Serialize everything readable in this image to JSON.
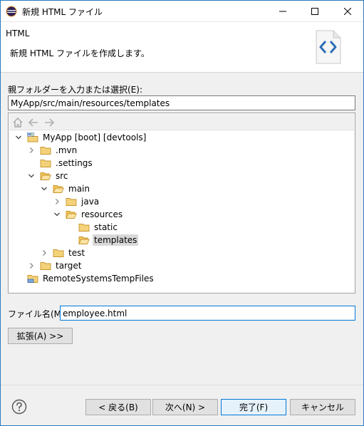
{
  "window": {
    "title": "新規 HTML ファイル",
    "controls": {
      "minimize": "minimize-icon",
      "maximize": "maximize-icon",
      "close": "close-icon"
    }
  },
  "banner": {
    "title": "HTML",
    "description": "新規 HTML ファイルを作成します。"
  },
  "parent_folder": {
    "label": "親フォルダーを入力または選択(E):",
    "value": "MyApp/src/main/resources/templates"
  },
  "tree": {
    "toolbar": [
      "home-icon",
      "back-arrow-icon",
      "forward-arrow-icon"
    ],
    "items": [
      {
        "label": "MyApp [boot] [devtools]",
        "depth": 0,
        "expander": "expanded",
        "icon": "project-icon"
      },
      {
        "label": ".mvn",
        "depth": 1,
        "expander": "collapsed",
        "icon": "folder-icon"
      },
      {
        "label": ".settings",
        "depth": 1,
        "expander": "none",
        "icon": "folder-icon"
      },
      {
        "label": "src",
        "depth": 1,
        "expander": "expanded",
        "icon": "folder-open-icon"
      },
      {
        "label": "main",
        "depth": 2,
        "expander": "expanded",
        "icon": "folder-open-icon"
      },
      {
        "label": "java",
        "depth": 3,
        "expander": "collapsed",
        "icon": "folder-icon"
      },
      {
        "label": "resources",
        "depth": 3,
        "expander": "expanded",
        "icon": "folder-open-icon"
      },
      {
        "label": "static",
        "depth": 4,
        "expander": "none",
        "icon": "folder-icon"
      },
      {
        "label": "templates",
        "depth": 4,
        "expander": "none",
        "icon": "folder-open-icon",
        "selected": true
      },
      {
        "label": "test",
        "depth": 2,
        "expander": "collapsed",
        "icon": "folder-icon"
      },
      {
        "label": "target",
        "depth": 1,
        "expander": "collapsed",
        "icon": "folder-icon"
      },
      {
        "label": "RemoteSystemsTempFiles",
        "depth": 0,
        "expander": "none",
        "icon": "remote-project-icon"
      }
    ]
  },
  "file_name": {
    "label": "ファイル名(M):",
    "value": "employee.html"
  },
  "buttons": {
    "advanced": "拡張(A) >>",
    "back": "< 戻る(B)",
    "next": "次へ(N) >",
    "finish": "完了(F)",
    "cancel": "キャンセル",
    "help": "help-icon"
  },
  "colors": {
    "accent": "#0078d7",
    "folder_fill": "#f4d27a",
    "folder_stroke": "#c8952a",
    "selection": "#d9d9d9"
  }
}
